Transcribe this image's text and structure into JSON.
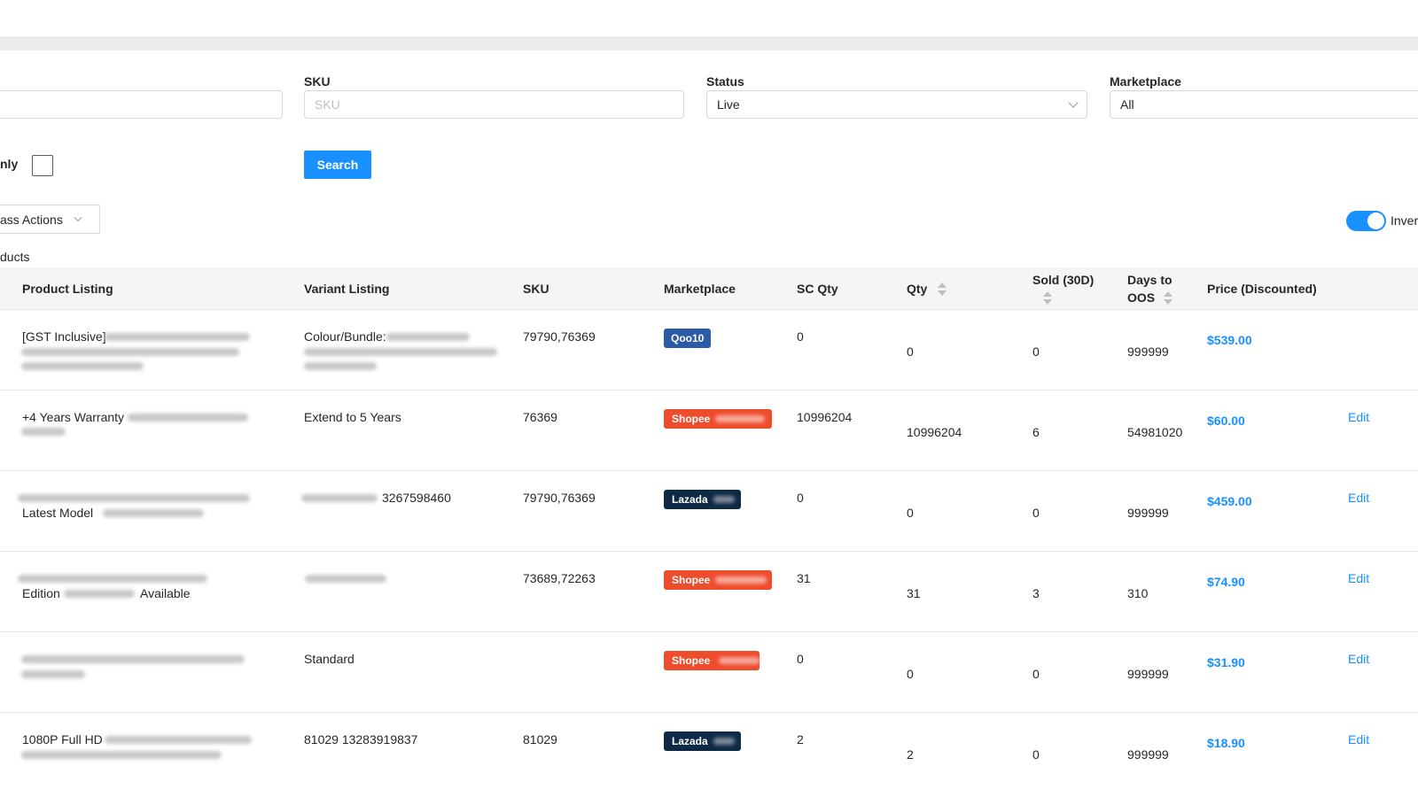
{
  "filters": {
    "sku": {
      "label": "SKU",
      "placeholder": "SKU"
    },
    "status": {
      "label": "Status",
      "value": "Live"
    },
    "marketplace": {
      "label": "Marketplace",
      "value": "All"
    },
    "only_label": "nly",
    "search_label": "Search"
  },
  "toolbar": {
    "mass_actions_label": "ass Actions",
    "toggle_label": "Inver",
    "toggle_on": true,
    "products_label": "ducts"
  },
  "table": {
    "columns": [
      "Product Listing",
      "Variant Listing",
      "SKU",
      "Marketplace",
      "SC Qty",
      "Qty",
      "Sold (30D)",
      "Days to OOS",
      "Price (Discounted)"
    ],
    "rows": [
      {
        "product_line1": "[GST Inclusive]",
        "product_line2": "",
        "variant_line1": "Colour/Bundle:",
        "sku": "79790,76369",
        "marketplace": "Qoo10",
        "sc_qty": "0",
        "qty": "0",
        "sold": "0",
        "days": "999999",
        "price": "$539.00",
        "edit": ""
      },
      {
        "product_line1": "+4 Years Warranty",
        "product_line2": "",
        "variant_line1": "Extend to 5 Years",
        "sku": "76369",
        "marketplace": "Shopee",
        "sc_qty": "10996204",
        "qty": "10996204",
        "sold": "6",
        "days": "54981020",
        "price": "$60.00",
        "edit": "Edit"
      },
      {
        "product_line1": "",
        "product_line2": "Latest Model",
        "variant_line1": "3267598460",
        "sku": "79790,76369",
        "marketplace": "Lazada",
        "sc_qty": "0",
        "qty": "0",
        "sold": "0",
        "days": "999999",
        "price": "$459.00",
        "edit": "Edit"
      },
      {
        "product_line1": "",
        "product_line2": "Edition",
        "product_line2b": "Available",
        "variant_line1": "",
        "sku": "73689,72263",
        "marketplace": "Shopee",
        "sc_qty": "31",
        "qty": "31",
        "sold": "3",
        "days": "310",
        "price": "$74.90",
        "edit": "Edit"
      },
      {
        "product_line1": "",
        "product_line2": "",
        "variant_line1": "Standard",
        "sku": "",
        "marketplace": "Shopee",
        "sc_qty": "0",
        "qty": "0",
        "sold": "0",
        "days": "999999",
        "price": "$31.90",
        "edit": "Edit"
      },
      {
        "product_line1": "1080P Full HD",
        "product_line2": "",
        "variant_line1": "81029 13283919837",
        "sku": "81029",
        "marketplace": "Lazada",
        "sc_qty": "2",
        "qty": "2",
        "sold": "0",
        "days": "999999",
        "price": "$18.90",
        "edit": "Edit"
      }
    ]
  },
  "colors": {
    "accent": "#1890ff",
    "qoo10": "#2b5aa7",
    "shopee": "#ee4d2d",
    "lazada": "#0f2a47"
  }
}
